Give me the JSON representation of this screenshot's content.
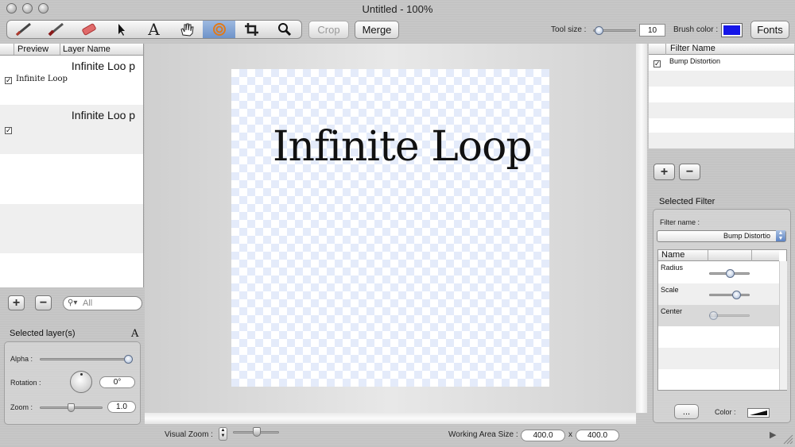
{
  "window": {
    "title": "Untitled - 100%"
  },
  "toolbar": {
    "tools": [
      {
        "name": "brush-icon",
        "glyph": "🖌"
      },
      {
        "name": "paintbrush-icon",
        "glyph": "🖌"
      },
      {
        "name": "eraser-icon",
        "glyph": "▰"
      },
      {
        "name": "pointer-icon",
        "glyph": "➤"
      },
      {
        "name": "text-icon",
        "glyph": "A"
      },
      {
        "name": "hand-icon",
        "glyph": "✋"
      },
      {
        "name": "swirl-icon",
        "glyph": "◎"
      },
      {
        "name": "crop-icon",
        "glyph": "⛶"
      },
      {
        "name": "magnifier-icon",
        "glyph": "🔍"
      }
    ],
    "crop_label": "Crop",
    "merge_label": "Merge",
    "tool_size_label": "Tool size :",
    "tool_size_value": "10",
    "tool_size_slider": 0.05,
    "brush_color_label": "Brush color :",
    "brush_color": "#1515e8",
    "fonts_label": "Fonts"
  },
  "layers": {
    "columns": [
      "Preview",
      "Layer Name"
    ],
    "rows": [
      {
        "checked": true,
        "preview": "Infinite Loop",
        "name": "Infinite Loo p"
      },
      {
        "checked": true,
        "preview": "",
        "name": "Infinite Loo p"
      }
    ],
    "add_label": "+",
    "remove_label": "−",
    "search_placeholder": "All"
  },
  "selected_layer": {
    "title": "Selected layer(s)",
    "alpha_label": "Alpha :",
    "alpha": 1.0,
    "rotation_label": "Rotation :",
    "rotation_value": "0°",
    "zoom_label": "Zoom :",
    "zoom_value": "1.0"
  },
  "canvas": {
    "text": "Infinite Loop"
  },
  "filters": {
    "column": "Filter Name",
    "rows": [
      {
        "checked": true,
        "name": "Bump Distortion"
      }
    ],
    "add_label": "+",
    "remove_label": "−"
  },
  "selected_filter": {
    "title": "Selected Filter",
    "filter_name_label": "Filter name :",
    "filter_name_value": "Bump Distortio",
    "param_header": "Name",
    "params": [
      {
        "name": "Radius",
        "value": 0.5
      },
      {
        "name": "Scale",
        "value": 0.7
      },
      {
        "name": "Center",
        "value": 0.0
      }
    ],
    "more_label": "...",
    "color_label": "Color :"
  },
  "statusbar": {
    "visual_zoom_label": "Visual Zoom :",
    "working_area_label": "Working Area Size :",
    "width": "400.0",
    "x_label": "x",
    "height": "400.0"
  },
  "colors": {
    "accent": "#6f93c9",
    "swirl": "#e07a1a"
  }
}
